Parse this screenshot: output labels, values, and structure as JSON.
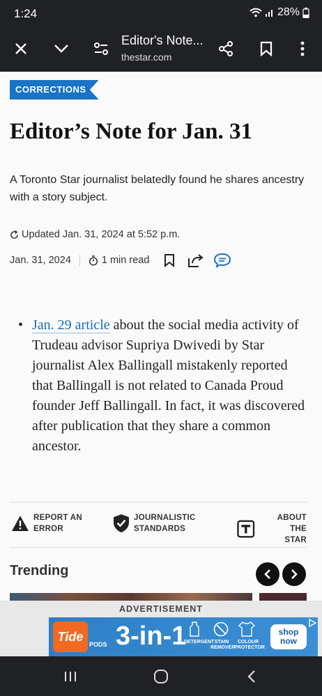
{
  "status_bar": {
    "time": "1:24",
    "battery": "28%"
  },
  "toolbar": {
    "title": "Editor's Note...",
    "url": "thestar.com"
  },
  "article": {
    "category": "CORRECTIONS",
    "headline": "Editor’s Note for Jan. 31",
    "summary": "A Toronto Star journalist belatedly found he shares ancestry with a story subject.",
    "updated": "Updated Jan. 31, 2024 at 5:52 p.m.",
    "date": "Jan. 31, 2024",
    "read_time": "1 min read",
    "body_link": "Jan. 29 article",
    "body_rest": " about the social media activity of Trudeau advisor Supriya Dwivedi by Star journalist Alex Ballingall mistakenly reported that Ballingall is not related to Canada Proud founder Jeff Ballingall. In fact, it was discovered after publication that they share a common ancestor."
  },
  "actions": {
    "report_line1": "REPORT AN",
    "report_line2": "ERROR",
    "standards_line1": "JOURNALISTIC",
    "standards_line2": "STANDARDS",
    "about_line1": "ABOUT THE",
    "about_line2": "STAR"
  },
  "trending": {
    "heading": "Trending"
  },
  "ad": {
    "label": "ADVERTISEMENT",
    "brand": "Tide",
    "brand_sub": "PODS",
    "headline": "3-in-1",
    "feature1_a": "DETERGENT",
    "feature2_a": "STAIN",
    "feature2_b": "REMOVER",
    "feature3_a": "COLOUR",
    "feature3_b": "PROTECTOR",
    "cta_line1": "shop",
    "cta_line2": "now"
  },
  "colors": {
    "accent": "#1a73c4",
    "link": "#1a6bb5",
    "chrome": "#202124"
  }
}
